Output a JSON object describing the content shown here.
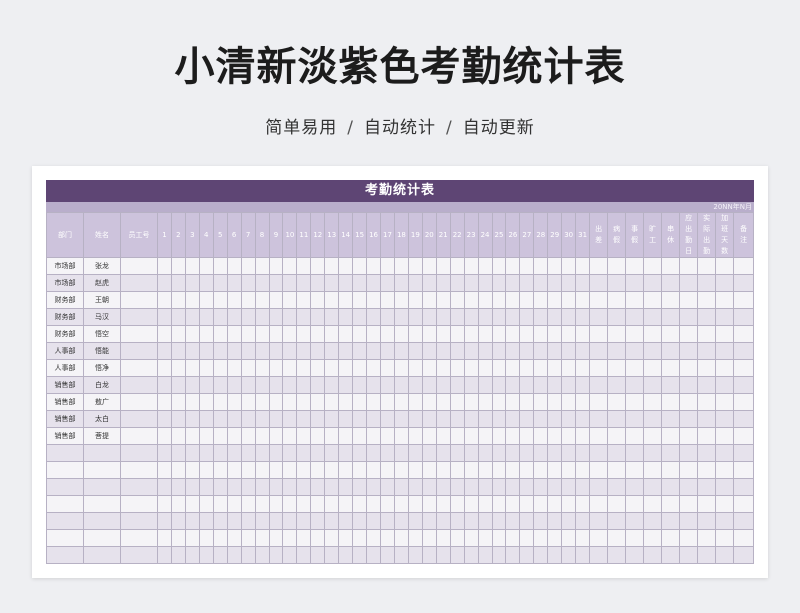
{
  "header": {
    "title": "小清新淡紫色考勤统计表",
    "subtitle": [
      "简单易用",
      "自动统计",
      "自动更新"
    ],
    "separator": "/"
  },
  "sheet": {
    "title": "考勤统计表",
    "date_label": "20NN年N月",
    "columns": {
      "dept": "部门",
      "name": "姓名",
      "emp_id": "员工号",
      "days": [
        "1",
        "2",
        "3",
        "4",
        "5",
        "6",
        "7",
        "8",
        "9",
        "10",
        "11",
        "12",
        "13",
        "14",
        "15",
        "16",
        "17",
        "18",
        "19",
        "20",
        "21",
        "22",
        "23",
        "24",
        "25",
        "26",
        "27",
        "28",
        "29",
        "30",
        "31"
      ],
      "summary": [
        "出差",
        "病假",
        "事假",
        "旷工",
        "串休",
        "应出勤日",
        "实际出勤",
        "加班天数",
        "备注"
      ]
    },
    "rows": [
      {
        "dept": "市场部",
        "name": "张龙"
      },
      {
        "dept": "市场部",
        "name": "赵虎"
      },
      {
        "dept": "财务部",
        "name": "王朝"
      },
      {
        "dept": "财务部",
        "name": "马汉"
      },
      {
        "dept": "财务部",
        "name": "悟空"
      },
      {
        "dept": "人事部",
        "name": "悟能"
      },
      {
        "dept": "人事部",
        "name": "悟净"
      },
      {
        "dept": "销售部",
        "name": "白龙"
      },
      {
        "dept": "销售部",
        "name": "敖广"
      },
      {
        "dept": "销售部",
        "name": "太白"
      },
      {
        "dept": "销售部",
        "name": "菩提"
      },
      {
        "dept": "",
        "name": ""
      },
      {
        "dept": "",
        "name": ""
      },
      {
        "dept": "",
        "name": ""
      },
      {
        "dept": "",
        "name": ""
      },
      {
        "dept": "",
        "name": ""
      },
      {
        "dept": "",
        "name": ""
      },
      {
        "dept": "",
        "name": ""
      }
    ]
  },
  "colors": {
    "title_bar": "#5e4574",
    "header_row": "#cdc3dc",
    "row_light": "#f5f4f7",
    "row_dark": "#e6e2ec"
  }
}
